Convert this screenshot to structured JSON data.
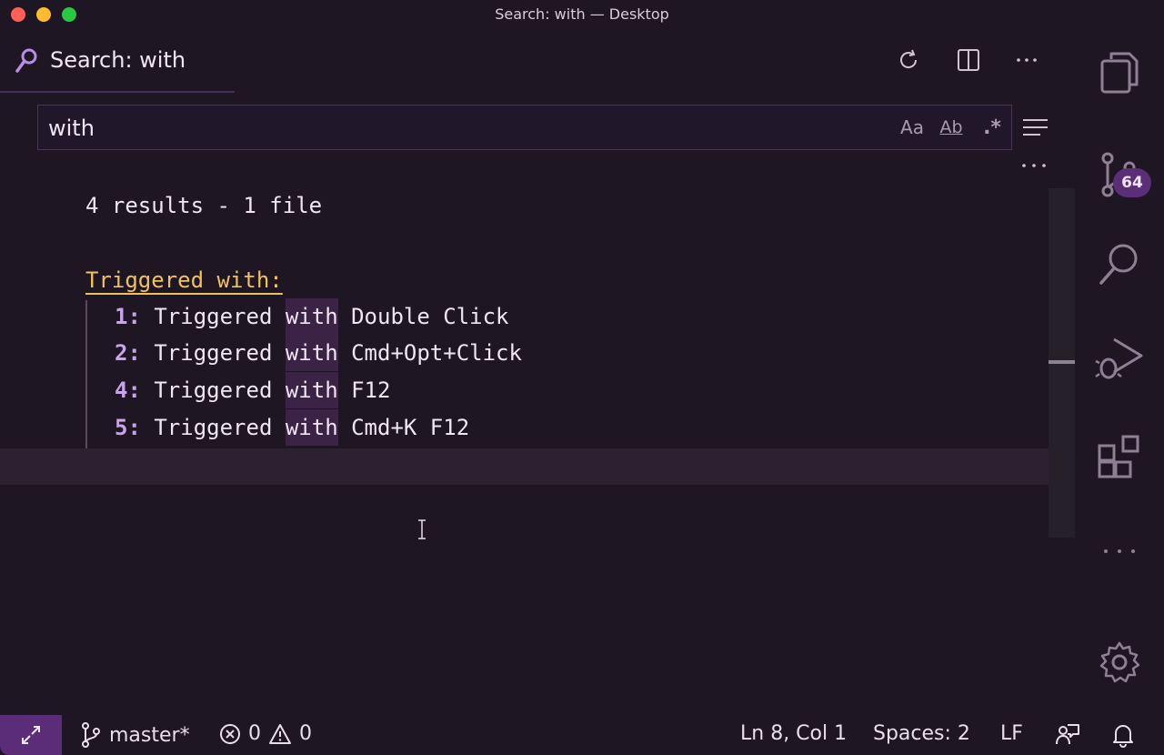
{
  "window": {
    "title": "Search: with — Desktop"
  },
  "tab": {
    "label": "Search: with"
  },
  "search": {
    "value": "with",
    "placeholder": "Search",
    "options": {
      "match_case": "Aa",
      "whole_word": "Ab",
      "regex": ".*"
    }
  },
  "results": {
    "summary": "4 results - 1 file",
    "file_header": "Triggered with:",
    "lines": [
      {
        "num": "1:",
        "before": " Triggered ",
        "match": "with",
        "after": " Double Click"
      },
      {
        "num": "2:",
        "before": " Triggered ",
        "match": "with",
        "after": " Cmd+Opt+Click"
      },
      {
        "num": "4:",
        "before": " Triggered ",
        "match": "with",
        "after": " F12"
      },
      {
        "num": "5:",
        "before": " Triggered ",
        "match": "with",
        "after": " Cmd+K F12"
      }
    ]
  },
  "activity_bar": {
    "scm_badge": "64"
  },
  "statusbar": {
    "branch": "master*",
    "errors": "0",
    "warnings": "0",
    "cursor_pos": "Ln 8, Col 1",
    "spaces": "Spaces: 2",
    "eol": "LF"
  },
  "colors": {
    "accent": "#5b2d79",
    "match_bg": "#3b2346",
    "file_header": "#f1c15c",
    "line_number": "#c8a5ea"
  }
}
